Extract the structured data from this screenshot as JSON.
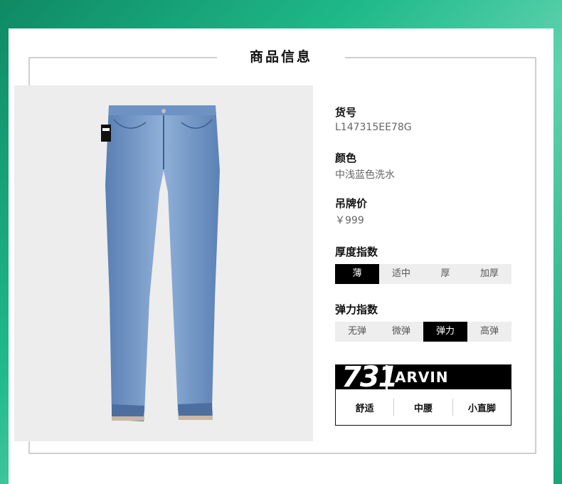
{
  "section_title": "商品信息",
  "product": {
    "sku_label": "货号",
    "sku_value": "L147315EE78G",
    "color_label": "颜色",
    "color_value": "中浅蓝色洗水",
    "price_label": "吊牌价",
    "price_value": "￥999"
  },
  "thickness": {
    "label": "厚度指数",
    "options": [
      "薄",
      "适中",
      "厚",
      "加厚"
    ],
    "selected": "薄"
  },
  "stretch": {
    "label": "弹力指数",
    "options": [
      "无弹",
      "微弹",
      "弹力",
      "高弹"
    ],
    "selected": "弹力"
  },
  "fit": {
    "number": "731",
    "name": "ARVIN",
    "tags": [
      "舒适",
      "中腰",
      "小直脚"
    ]
  },
  "colors": {
    "accent": "#000000",
    "denim": "#6f93c4",
    "background_green": "#1fb98a"
  }
}
